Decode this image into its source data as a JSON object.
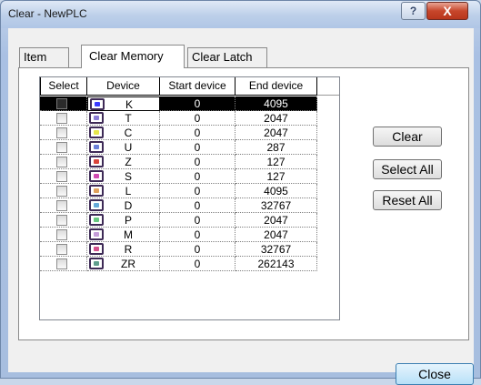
{
  "window": {
    "title": "Clear - NewPLC",
    "help_label": "?",
    "close_label": "X"
  },
  "tabs": [
    {
      "label": "Item"
    },
    {
      "label": "Clear Memory",
      "active": true
    },
    {
      "label": "Clear Latch"
    }
  ],
  "table": {
    "headers": [
      "Select",
      "Device",
      "Start device",
      "End device"
    ],
    "rows": [
      {
        "checked": false,
        "device": "K",
        "start": "0",
        "end": "4095",
        "icon_color": "#3b3bff",
        "selected": true
      },
      {
        "checked": false,
        "device": "T",
        "start": "0",
        "end": "2047",
        "icon_color": "#8a7bd6"
      },
      {
        "checked": false,
        "device": "C",
        "start": "0",
        "end": "2047",
        "icon_color": "#e6e64a"
      },
      {
        "checked": false,
        "device": "U",
        "start": "0",
        "end": "287",
        "icon_color": "#6a80d8"
      },
      {
        "checked": false,
        "device": "Z",
        "start": "0",
        "end": "127",
        "icon_color": "#d9443a"
      },
      {
        "checked": false,
        "device": "S",
        "start": "0",
        "end": "127",
        "icon_color": "#d14bb2"
      },
      {
        "checked": false,
        "device": "L",
        "start": "0",
        "end": "4095",
        "icon_color": "#e0a25c"
      },
      {
        "checked": false,
        "device": "D",
        "start": "0",
        "end": "32767",
        "icon_color": "#64a9d8"
      },
      {
        "checked": false,
        "device": "P",
        "start": "0",
        "end": "2047",
        "icon_color": "#67c87f"
      },
      {
        "checked": false,
        "device": "M",
        "start": "0",
        "end": "2047",
        "icon_color": "#c49bd8"
      },
      {
        "checked": false,
        "device": "R",
        "start": "0",
        "end": "32767",
        "icon_color": "#d4508d"
      },
      {
        "checked": false,
        "device": "ZR",
        "start": "0",
        "end": "262143",
        "icon_color": "#5f9d8c"
      }
    ]
  },
  "buttons": {
    "clear": "Clear",
    "select_all": "Select All",
    "reset_all": "Reset All",
    "close": "Close"
  }
}
